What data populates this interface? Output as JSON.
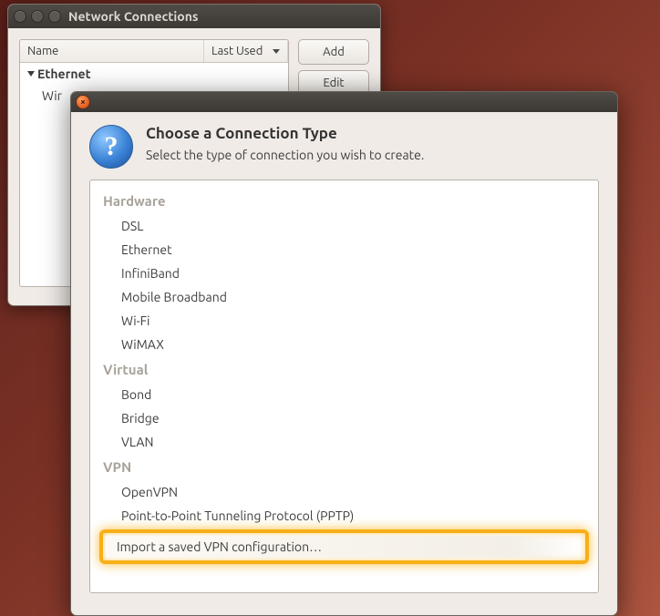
{
  "netWindow": {
    "title": "Network Connections",
    "columns": {
      "name": "Name",
      "lastUsed": "Last Used"
    },
    "group": "Ethernet",
    "item": "Wir",
    "buttons": {
      "add": "Add",
      "edit": "Edit"
    }
  },
  "dialog": {
    "title": "Choose a Connection Type",
    "subtitle": "Select the type of connection you wish to create.",
    "groups": [
      {
        "label": "Hardware",
        "items": [
          "DSL",
          "Ethernet",
          "InfiniBand",
          "Mobile Broadband",
          "Wi-Fi",
          "WiMAX"
        ]
      },
      {
        "label": "Virtual",
        "items": [
          "Bond",
          "Bridge",
          "VLAN"
        ]
      },
      {
        "label": "VPN",
        "items": [
          "OpenVPN",
          "Point-to-Point Tunneling Protocol (PPTP)",
          "Import a saved VPN configuration…"
        ]
      }
    ]
  }
}
